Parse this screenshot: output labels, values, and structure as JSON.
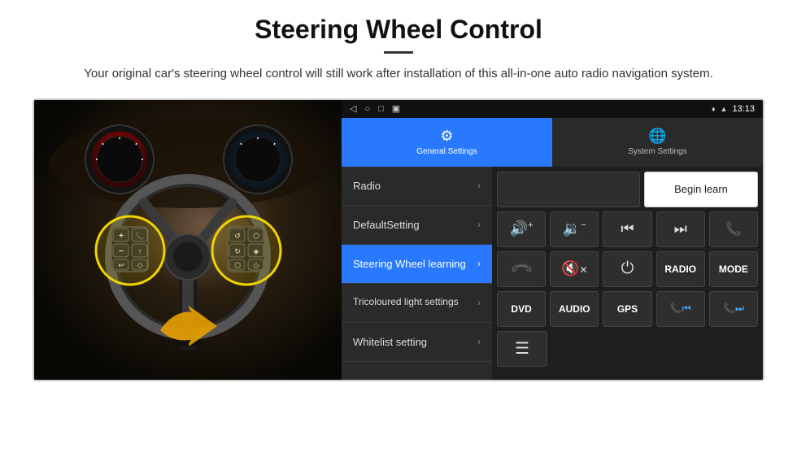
{
  "header": {
    "title": "Steering Wheel Control",
    "subtitle": "Your original car's steering wheel control will still work after installation of this all-in-one auto radio navigation system."
  },
  "status_bar": {
    "time": "13:13",
    "nav_icon": "◁",
    "home_icon": "○",
    "recent_icon": "□",
    "screenshot_icon": "▣"
  },
  "top_nav": {
    "tabs": [
      {
        "id": "general",
        "icon": "⚙",
        "label": "General Settings",
        "active": true
      },
      {
        "id": "system",
        "icon": "🌐",
        "label": "System Settings",
        "active": false
      }
    ]
  },
  "menu": {
    "items": [
      {
        "id": "radio",
        "label": "Radio",
        "active": false
      },
      {
        "id": "default-setting",
        "label": "DefaultSetting",
        "active": false
      },
      {
        "id": "steering-wheel",
        "label": "Steering Wheel learning",
        "active": true
      },
      {
        "id": "tricoloured",
        "label": "Tricoloured light settings",
        "active": false
      },
      {
        "id": "whitelist",
        "label": "Whitelist setting",
        "active": false
      }
    ]
  },
  "controls": {
    "begin_learn_label": "Begin learn",
    "row2": [
      {
        "id": "vol-up",
        "symbol": "🔊+",
        "text": "🔊+"
      },
      {
        "id": "vol-down",
        "symbol": "🔉−",
        "text": "🔉−"
      },
      {
        "id": "prev-track",
        "symbol": "⏮",
        "text": "⏮"
      },
      {
        "id": "next-track",
        "symbol": "⏭",
        "text": "⏭"
      },
      {
        "id": "phone",
        "symbol": "📞",
        "text": "📞"
      }
    ],
    "row3": [
      {
        "id": "hang-up",
        "symbol": "📵",
        "text": "↩"
      },
      {
        "id": "mute",
        "symbol": "🔇",
        "text": "🔇×"
      },
      {
        "id": "power",
        "symbol": "⏻",
        "text": "⏻"
      },
      {
        "id": "radio-btn",
        "label": "RADIO",
        "text": "RADIO"
      },
      {
        "id": "mode-btn",
        "label": "MODE",
        "text": "MODE"
      }
    ],
    "row4": [
      {
        "id": "dvd-btn",
        "label": "DVD",
        "text": "DVD"
      },
      {
        "id": "audio-btn",
        "label": "AUDIO",
        "text": "AUDIO"
      },
      {
        "id": "gps-btn",
        "label": "GPS",
        "text": "GPS"
      },
      {
        "id": "prev-combo",
        "symbol": "📞⏮",
        "text": "📞⏮"
      },
      {
        "id": "next-combo",
        "symbol": "📞⏭",
        "text": "📞⏭"
      }
    ],
    "row5": [
      {
        "id": "whitelist-icon",
        "symbol": "📋",
        "text": "☰"
      }
    ]
  }
}
